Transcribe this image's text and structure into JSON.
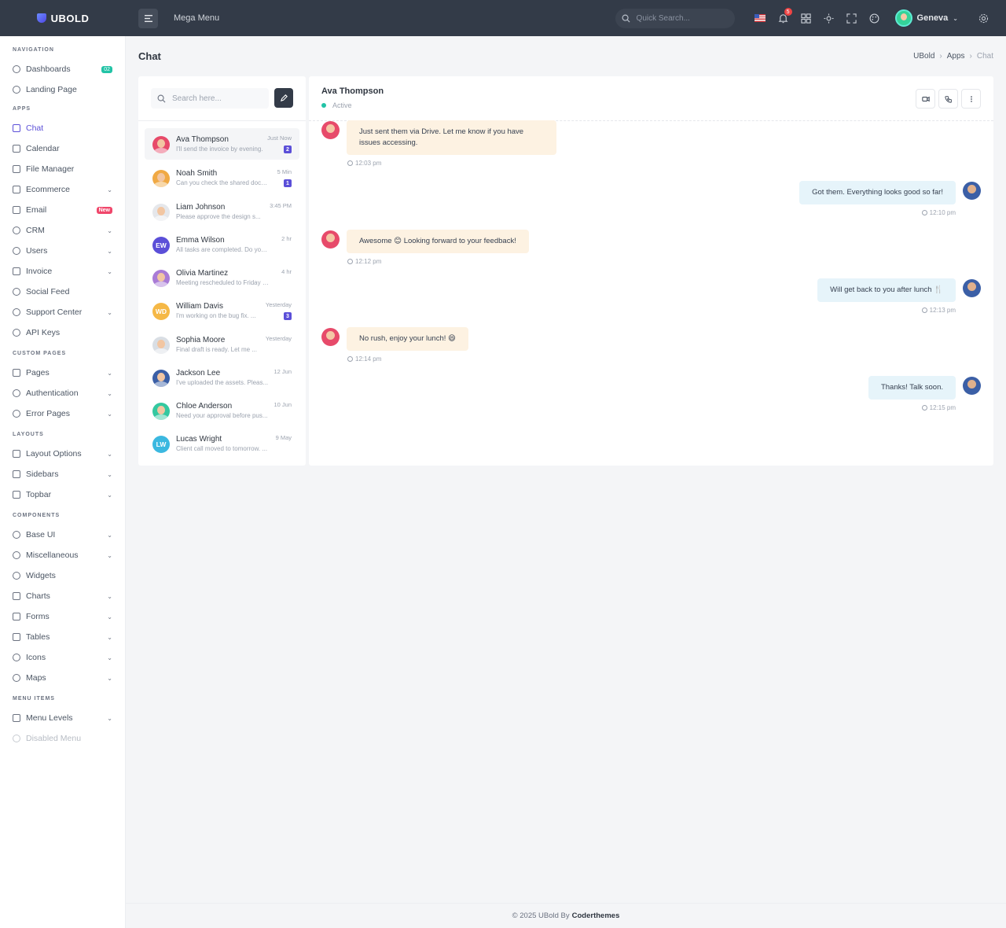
{
  "topbar": {
    "brand": "UBOLD",
    "mega_menu": "Mega Menu",
    "search_placeholder": "Quick Search...",
    "notification_count": "5",
    "user_name": "Geneva"
  },
  "sidebar": {
    "sections": {
      "navigation": "NAVIGATION",
      "apps": "APPS",
      "custom_pages": "CUSTOM PAGES",
      "layouts": "LAYOUTS",
      "components": "COMPONENTS",
      "menu_items": "MENU ITEMS"
    },
    "items": {
      "dashboards": "Dashboards",
      "dashboards_badge": "02",
      "landing_page": "Landing Page",
      "chat": "Chat",
      "calendar": "Calendar",
      "file_manager": "File Manager",
      "ecommerce": "Ecommerce",
      "email": "Email",
      "email_badge": "New",
      "crm": "CRM",
      "users": "Users",
      "invoice": "Invoice",
      "social_feed": "Social Feed",
      "support_center": "Support Center",
      "api_keys": "API Keys",
      "pages": "Pages",
      "authentication": "Authentication",
      "error_pages": "Error Pages",
      "layout_options": "Layout Options",
      "sidebars": "Sidebars",
      "topbar": "Topbar",
      "base_ui": "Base UI",
      "miscellaneous": "Miscellaneous",
      "widgets": "Widgets",
      "charts": "Charts",
      "forms": "Forms",
      "tables": "Tables",
      "icons": "Icons",
      "maps": "Maps",
      "menu_levels": "Menu Levels",
      "disabled_menu": "Disabled Menu"
    }
  },
  "page": {
    "title": "Chat",
    "breadcrumb": [
      "UBold",
      "Apps",
      "Chat"
    ]
  },
  "chat_list": {
    "search_placeholder": "Search here...",
    "contacts": [
      {
        "name": "Ava Thompson",
        "message": "I'll send the invoice by evening.",
        "time": "Just Now",
        "unread": "2",
        "avatar": "photo",
        "color": "#e74a6a"
      },
      {
        "name": "Noah Smith",
        "message": "Can you check the shared doc? ...",
        "time": "5 Min",
        "unread": "1",
        "avatar": "photo",
        "color": "#f0a944"
      },
      {
        "name": "Liam Johnson",
        "message": "Please approve the design s...",
        "time": "3:45 PM",
        "unread": "",
        "avatar": "photo",
        "color": "#e5e7eb"
      },
      {
        "name": "Emma Wilson",
        "message": "All tasks are completed. Do you ...",
        "time": "2 hr",
        "unread": "",
        "avatar": "EW",
        "color": "#5b4fd8"
      },
      {
        "name": "Olivia Martinez",
        "message": "Meeting rescheduled to Friday at ...",
        "time": "4 hr",
        "unread": "",
        "avatar": "photo",
        "color": "#a97bd6"
      },
      {
        "name": "William Davis",
        "message": "I'm working on the bug fix. ...",
        "time": "Yesterday",
        "unread": "3",
        "avatar": "WD",
        "color": "#f5b846"
      },
      {
        "name": "Sophia Moore",
        "message": "Final draft is ready. Let me ...",
        "time": "Yesterday",
        "unread": "",
        "avatar": "photo",
        "color": "#d9dee4"
      },
      {
        "name": "Jackson Lee",
        "message": "I've uploaded the assets. Pleas...",
        "time": "12 Jun",
        "unread": "",
        "avatar": "photo",
        "color": "#3b5fa6"
      },
      {
        "name": "Chloe Anderson",
        "message": "Need your approval before pus...",
        "time": "10 Jun",
        "unread": "",
        "avatar": "photo",
        "color": "#34c8a0"
      },
      {
        "name": "Lucas Wright",
        "message": "Client call moved to tomorrow. ...",
        "time": "9 May",
        "unread": "",
        "avatar": "LW",
        "color": "#3bb8e0"
      }
    ]
  },
  "conversation": {
    "name": "Ava Thompson",
    "status": "Active",
    "messages": [
      {
        "dir": "in",
        "text": "Just sent them via Drive. Let me know if you have issues accessing.",
        "time": "12:03 pm"
      },
      {
        "dir": "out",
        "text": "Got them. Everything looks good so far!",
        "time": "12:10 pm"
      },
      {
        "dir": "in",
        "text": "Awesome 😊 Looking forward to your feedback!",
        "time": "12:12 pm"
      },
      {
        "dir": "out",
        "text": "Will get back to you after lunch 🍴",
        "time": "12:13 pm"
      },
      {
        "dir": "in",
        "text": "No rush, enjoy your lunch! 😄",
        "time": "12:14 pm"
      },
      {
        "dir": "out",
        "text": "Thanks! Talk soon.",
        "time": "12:15 pm"
      }
    ]
  },
  "footer": {
    "text": "© 2025 UBold By",
    "brand": "Coderthemes"
  }
}
